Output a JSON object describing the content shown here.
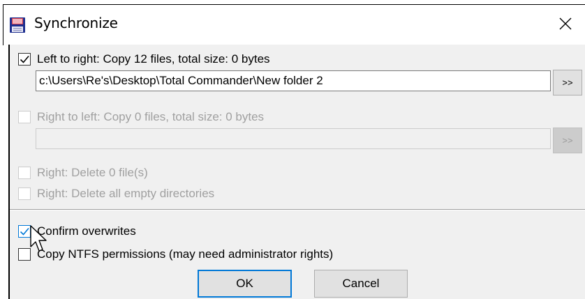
{
  "window": {
    "title": "Synchronize",
    "icon": "floppy-disk-icon",
    "close_icon": "close-icon"
  },
  "left_to_right": {
    "checked": true,
    "label": "Left to right: Copy 12 files, total size: 0 bytes",
    "path": "c:\\Users\\Re's\\Desktop\\Total Commander\\New folder 2",
    "browse_label": ">>"
  },
  "right_to_left": {
    "checked": false,
    "enabled": false,
    "label": "Right to left: Copy 0 files, total size: 0 bytes",
    "path": "",
    "browse_label": ">>"
  },
  "right_delete_files": {
    "checked": false,
    "enabled": false,
    "label": "Right: Delete 0 file(s)"
  },
  "right_delete_empty_dirs": {
    "checked": false,
    "enabled": false,
    "label": "Right: Delete all empty directories"
  },
  "confirm_overwrites": {
    "checked": true,
    "label": "Confirm overwrites"
  },
  "copy_ntfs_permissions": {
    "checked": false,
    "label": "Copy NTFS permissions (may need administrator rights)"
  },
  "buttons": {
    "ok": "OK",
    "cancel": "Cancel"
  },
  "colors": {
    "accent": "#0078d7",
    "dialog_bg": "#f0f0f0",
    "disabled_text": "#a0a0a0"
  }
}
